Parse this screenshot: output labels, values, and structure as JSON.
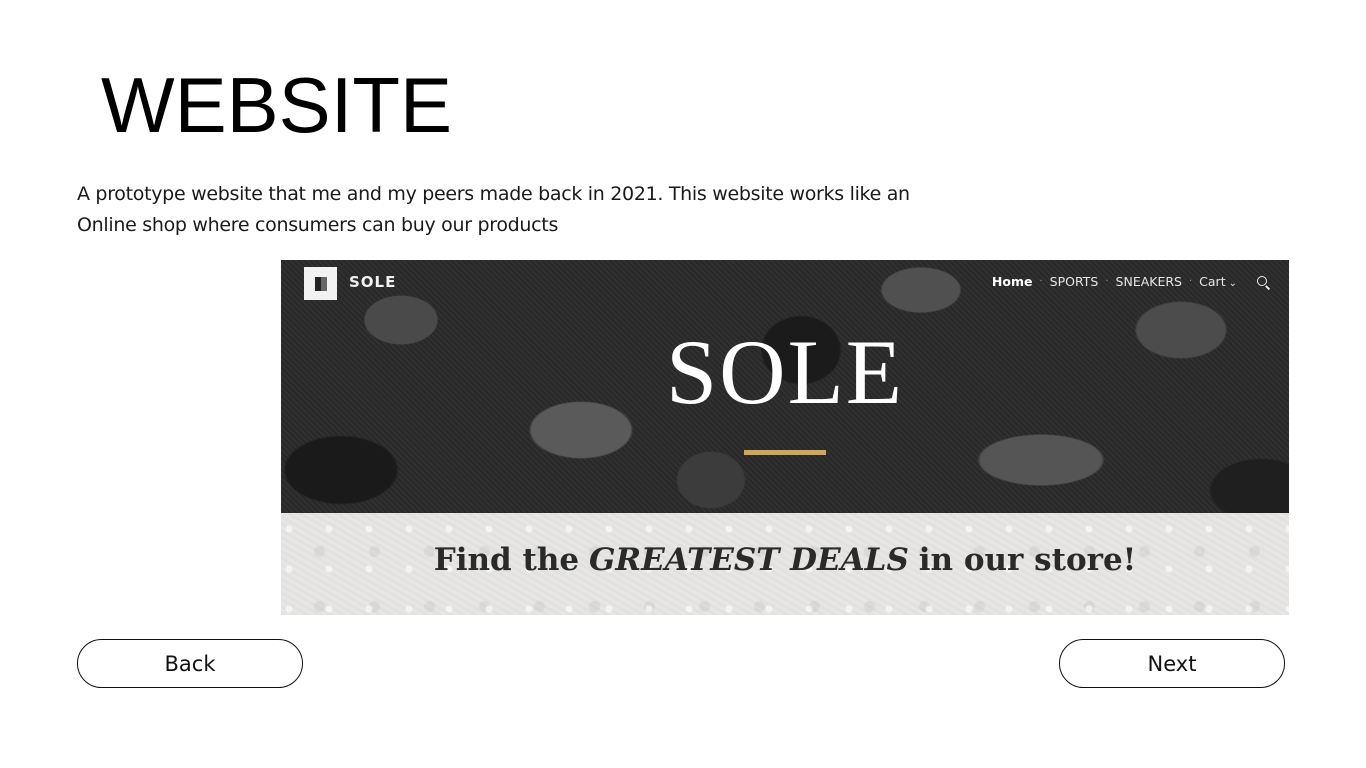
{
  "page": {
    "title": "WEBSITE",
    "description_lines": [
      "A prototype website that me and my peers made back in 2021. This website works like an",
      "Online shop where consumers can buy our products"
    ]
  },
  "screenshot": {
    "brand": "SOLE",
    "logo_icon": "sole-logo-icon",
    "nav": {
      "home": "Home",
      "sports": "SPORTS",
      "sneakers": "SNEAKERS",
      "cart": "Cart",
      "sep": "·",
      "cart_chevron": "⌄",
      "search_icon": "search-icon"
    },
    "hero_title": "SOLE",
    "tagline": {
      "prefix": "Find the",
      "highlight": "GREATEST DEALS",
      "suffix": "in our store!"
    },
    "colors": {
      "accent_rule": "#c9a864"
    }
  },
  "buttons": {
    "back": "Back",
    "next": "Next"
  }
}
